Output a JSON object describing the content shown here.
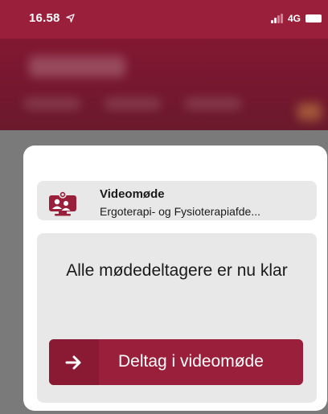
{
  "status_bar": {
    "time": "16.58",
    "network": "4G"
  },
  "meeting": {
    "title": "Videomøde",
    "subtitle": "Ergoterapi- og Fysioterapiafde...",
    "icon": "video-meeting-icon"
  },
  "status_message": "Alle mødedeltagere er nu klar",
  "join_button": {
    "label": "Deltag i videomøde",
    "icon": "arrow-right-icon"
  },
  "colors": {
    "brand": "#9a1f3a",
    "card_background": "#e8e8e8"
  }
}
